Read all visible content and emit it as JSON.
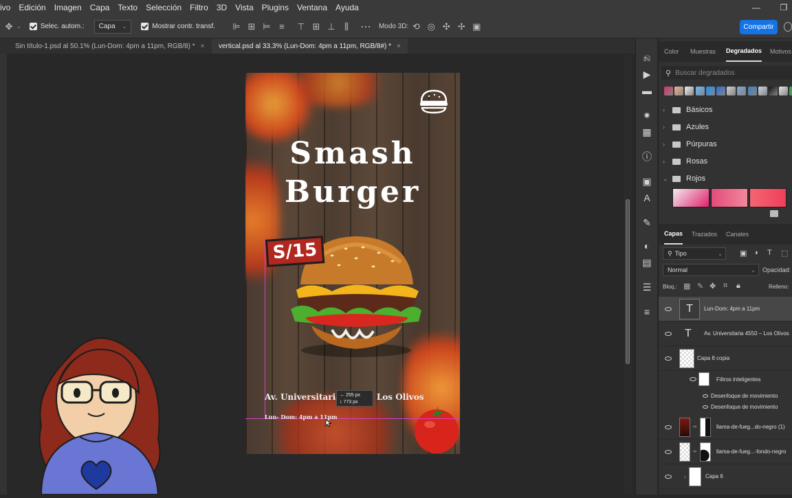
{
  "menu": [
    "ivo",
    "Edición",
    "Imagen",
    "Capa",
    "Texto",
    "Selección",
    "Filtro",
    "3D",
    "Vista",
    "Plugins",
    "Ventana",
    "Ayuda"
  ],
  "options": {
    "auto_select_label": "Selec. autom.:",
    "auto_select_value": "Capa",
    "show_transform_label": "Mostrar contr. transf.",
    "mode3d_label": "Modo 3D:",
    "share_label": "Compartir"
  },
  "tabs": [
    {
      "label": "Sin título-1.psd al 50.1% (Lun-Dom: 4pm a 11pm, RGB/8) *",
      "close": "×"
    },
    {
      "label": "vertical.psd al 33.3% (Lun-Dom: 4pm a 11pm, RGB/8#) *",
      "close": "×"
    }
  ],
  "poster": {
    "title_line1": "Smash",
    "title_line2": "Burger",
    "price": "S/15",
    "address": "Av. Universitaria 4550 – Los Olivos",
    "hours": "Lun- Dom: 4pm a 11pm",
    "measure_w": "255 px",
    "measure_h": "773 px"
  },
  "panel_top": {
    "tabs": [
      "Color",
      "Muestras",
      "Degradados",
      "Motivos"
    ],
    "search_placeholder": "Buscar degradados",
    "folders": [
      "Básicos",
      "Azules",
      "Púrpuras",
      "Rosas",
      "Rojos"
    ],
    "swatches": [
      "#d6336c",
      "#f2b38a",
      "#f0f0f0",
      "#69b9ff",
      "#1e90ff",
      "#2d6fd6",
      "#d0d0d0",
      "#7fa8d8",
      "#3b82c4",
      "#c9d6e6",
      "#111111",
      "#e6e6e6",
      "#2aa84a"
    ]
  },
  "layers_panel": {
    "tabs": [
      "Capas",
      "Trazados",
      "Canales"
    ],
    "filter_label": "Tipo",
    "blend_mode": "Normal",
    "opacity_label": "Opacidad:",
    "lock_label": "Bloq.:",
    "fill_label": "Relleno:",
    "layers": [
      {
        "name": "Lun-Dom: 4pm a 11pm",
        "type": "text",
        "selected": true
      },
      {
        "name": "Av. Universitaria 4550 – Los Olivos",
        "type": "text",
        "selected": false
      },
      {
        "name": "Capa 8 copia",
        "type": "smart",
        "selected": false
      },
      {
        "name": "Filtros inteligentes",
        "type": "filter-group",
        "selected": false
      },
      {
        "name": "Desenfoque de movimiento",
        "type": "filter",
        "selected": false
      },
      {
        "name": "Desenfoque de movimiento",
        "type": "filter",
        "selected": false
      },
      {
        "name": "llama-de-fueg...do-negro (1)",
        "type": "masked",
        "selected": false
      },
      {
        "name": "llama-de-fueg...-fondo-negro",
        "type": "masked",
        "selected": false
      },
      {
        "name": "Capa 6",
        "type": "clipped",
        "selected": false
      }
    ]
  }
}
